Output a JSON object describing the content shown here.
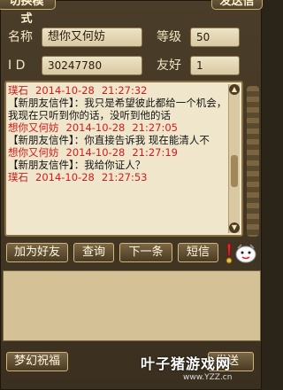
{
  "tabs": {
    "left": "切换模式",
    "right": "发送信"
  },
  "profile": {
    "name_label": "名称",
    "name_value": "想你又何妨",
    "level_label": "等级",
    "level_value": "50",
    "id_label": "I D",
    "id_value": "30247780",
    "friendship_label": "友好",
    "friendship_value": "1"
  },
  "messages": [
    {
      "sender": "璞石",
      "date": "2014-10-28",
      "time": "21:27:32",
      "text": "【新朋友信件】：我只是希望彼此都给一个机会，我现在只听到你的话，没听到他的话"
    },
    {
      "sender": "想你又何妨",
      "date": "2014-10-28",
      "time": "21:27:05",
      "text": "【新朋友信件】：你直接告诉我  现在能清人不"
    },
    {
      "sender": "想你又何妨",
      "date": "2014-10-28",
      "time": "21:27:19",
      "text": "【新朋友信件】：我给你证人？"
    },
    {
      "sender": "璞石",
      "date": "2014-10-28",
      "time": "21:27:53",
      "text": ""
    }
  ],
  "actions": {
    "add_friend": "加为好友",
    "query": "查询",
    "next": "下一条",
    "sms": "短信"
  },
  "bottom": {
    "blessing": "梦幻祝福",
    "send": "发送",
    "watermark": "叶子猪游戏网",
    "watermark_url": "www.YZZ.cn"
  },
  "colors": {
    "meta_red": "#d21d1d",
    "chat_bg": "#efe6cc",
    "frame": "#4a3d29"
  }
}
